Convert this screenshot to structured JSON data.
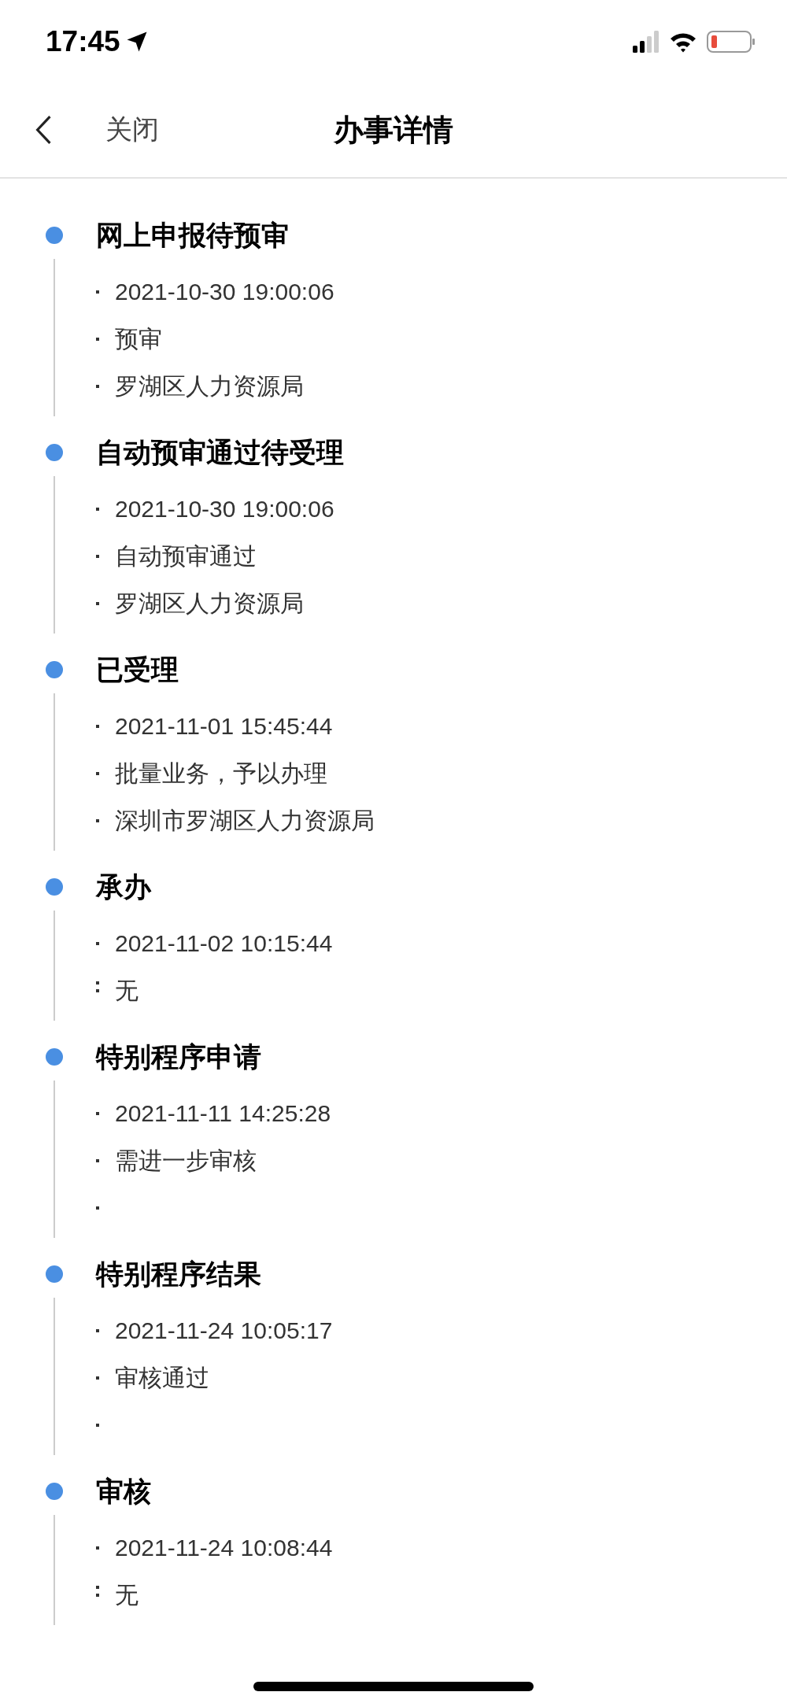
{
  "status_bar": {
    "time": "17:45"
  },
  "nav": {
    "back_label": "关闭",
    "title": "办事详情"
  },
  "steps": [
    {
      "title": "网上申报待预审",
      "lines": [
        {
          "kind": "dot",
          "text": "2021-10-30 19:00:06"
        },
        {
          "kind": "dot",
          "text": "预审"
        },
        {
          "kind": "dot",
          "text": "罗湖区人力资源局"
        }
      ]
    },
    {
      "title": "自动预审通过待受理",
      "lines": [
        {
          "kind": "dot",
          "text": "2021-10-30 19:00:06"
        },
        {
          "kind": "dot",
          "text": "自动预审通过"
        },
        {
          "kind": "dot",
          "text": "罗湖区人力资源局"
        }
      ]
    },
    {
      "title": "已受理",
      "lines": [
        {
          "kind": "dot",
          "text": "2021-11-01 15:45:44"
        },
        {
          "kind": "dot",
          "text": "批量业务，予以办理"
        },
        {
          "kind": "dot",
          "text": "深圳市罗湖区人力资源局"
        }
      ]
    },
    {
      "title": "承办",
      "lines": [
        {
          "kind": "dot",
          "text": "2021-11-02 10:15:44"
        },
        {
          "kind": "colon",
          "text": "无"
        }
      ]
    },
    {
      "title": "特别程序申请",
      "lines": [
        {
          "kind": "dot",
          "text": "2021-11-11 14:25:28"
        },
        {
          "kind": "dot",
          "text": "需进一步审核"
        },
        {
          "kind": "dot"
        }
      ]
    },
    {
      "title": "特别程序结果",
      "lines": [
        {
          "kind": "dot",
          "text": "2021-11-24 10:05:17"
        },
        {
          "kind": "dot",
          "text": "审核通过"
        },
        {
          "kind": "dot"
        }
      ]
    },
    {
      "title": "审核",
      "lines": [
        {
          "kind": "dot",
          "text": "2021-11-24 10:08:44"
        },
        {
          "kind": "colon",
          "text": "无"
        }
      ]
    }
  ]
}
